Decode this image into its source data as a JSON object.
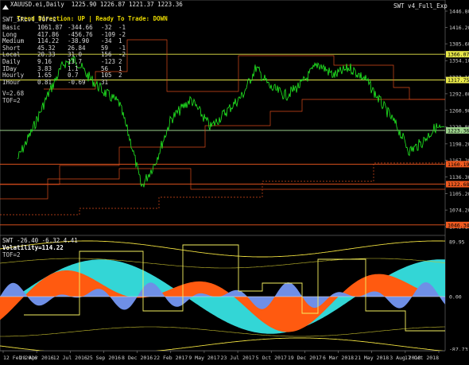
{
  "window": {
    "symbol_line": "XAUUSD.ei,Daily  1225.90 1226.87 1221.37 1223.36",
    "trend_label": "Trend Direction:",
    "trend_value": "UP",
    "sep": "|",
    "ready_label": "Ready To Trade:",
    "ready_value": "DOWN",
    "ea_name": "SWT v4_Full_Exp",
    "subtitle": "SWT_SRLvl_TOF=2"
  },
  "table": [
    [
      "Basic",
      "1061.87",
      "-344.66",
      "-32",
      "-1"
    ],
    [
      "Long",
      "417.86",
      "-456.76",
      "-109",
      "-2"
    ],
    [
      "Medium",
      "114.22",
      "-38.90",
      "-34",
      "1"
    ],
    [
      "Short",
      "45.32",
      "26.84",
      "59",
      "-1"
    ],
    [
      "Local",
      "20.33",
      "31.0",
      "156",
      "-2"
    ],
    [
      "Daily",
      "9.16",
      "13.7",
      "-123",
      "2"
    ],
    [
      "IDay",
      "3.83",
      "1.1",
      "56",
      "1"
    ],
    [
      "Hourly",
      "1.65",
      "0.7",
      "105",
      "2"
    ],
    [
      "IHour",
      "0.81",
      "-0.69",
      "31",
      ""
    ]
  ],
  "footer_lines": [
    "V=2.68",
    "TOF=2"
  ],
  "price_axis": [
    "1446.80",
    "1416.20",
    "1385.60",
    "1354.10",
    "1323.10",
    "1292.00",
    "1260.90",
    "1229.80",
    "1198.20",
    "1167.20",
    "1136.30",
    "1105.20",
    "1074.20",
    "1043.10"
  ],
  "levels": [
    {
      "value": "1366.07",
      "color": "#e8e84a",
      "text_color": "#000000"
    },
    {
      "value": "1317.75",
      "color": "#e8e84a",
      "text_color": "#000000"
    },
    {
      "value": "1223.36",
      "color": "#9bd18b",
      "text_color": "#000000"
    },
    {
      "value": "1160.19",
      "color": "#f05a20",
      "text_color": "#000000"
    },
    {
      "value": "1122.68",
      "color": "#f05a20",
      "text_color": "#000000"
    },
    {
      "value": "1046.34",
      "color": "#f05a20",
      "text_color": "#000000"
    }
  ],
  "subwindow": {
    "title": "SWT -26.40 -6.32 4.41",
    "volatility": "Volatility=114.22",
    "tof": "TOF=2",
    "axis": [
      "89.95",
      "0.00",
      "-87.73"
    ]
  },
  "x_axis": [
    "12 Feb 2016",
    "28 Apr 2016",
    "12 Jul 2016",
    "25 Sep 2016",
    "8 Dec 2016",
    "22 Feb 2017",
    "9 May 2017",
    "23 Jul 2017",
    "5 Oct 2017",
    "19 Dec 2017",
    "6 Mar 2018",
    "21 May 2018",
    "3 Aug 2018",
    "17 Oct 2018"
  ],
  "colors": {
    "price": "#22ee22",
    "resistance": "#d94a1a",
    "cyan": "#33d6d6",
    "orange": "#ff5a10",
    "blue": "#6f8fe6",
    "yellow": "#f5f060",
    "up_text": "#e8d800"
  },
  "icons": {
    "up_arrow": "triangle-up-icon"
  }
}
